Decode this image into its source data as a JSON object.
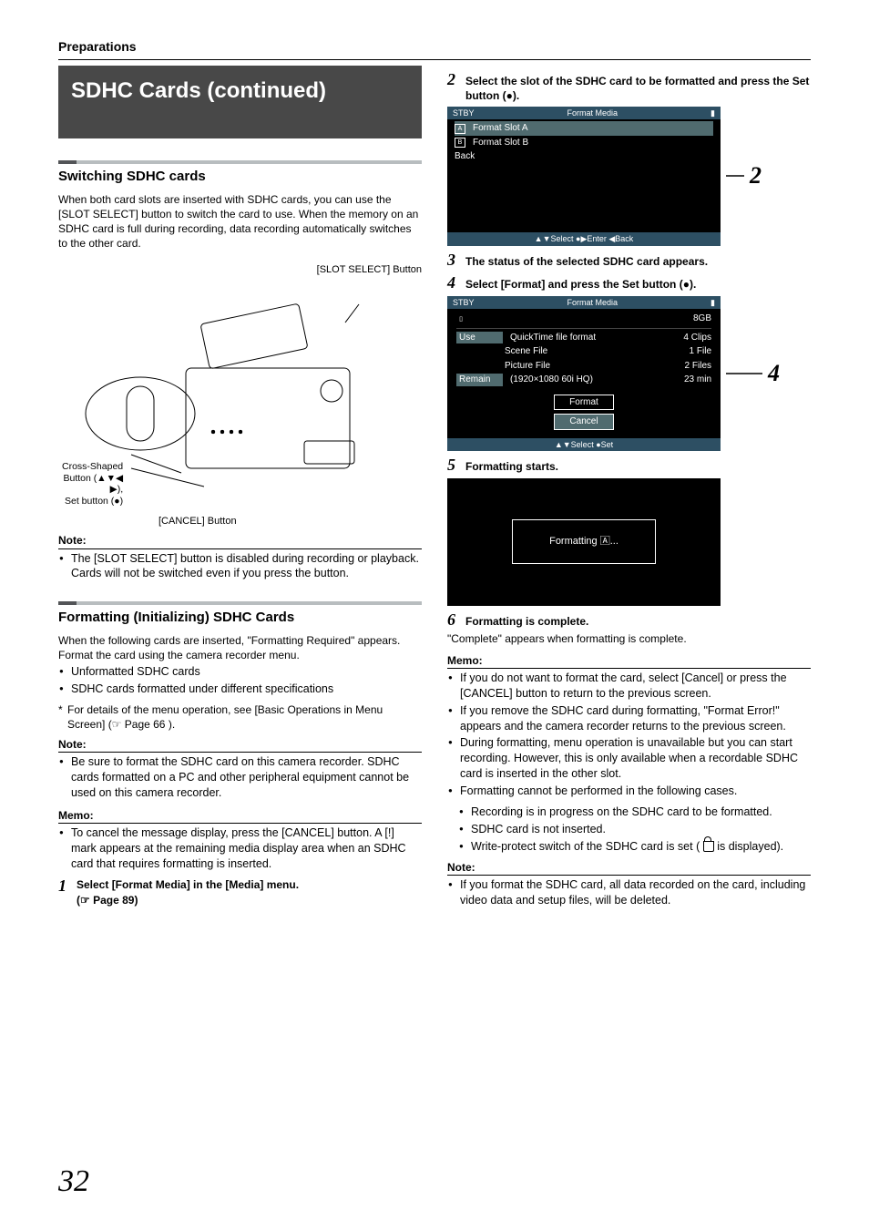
{
  "header": "Preparations",
  "title": "SDHC Cards (continued)",
  "page_number": "32",
  "sec1": {
    "heading": "Switching SDHC cards",
    "para": "When both card slots are inserted with SDHC cards, you can use the [SLOT SELECT] button to switch the card to use. When the memory on an SDHC card is full during recording, data recording automatically switches to the other card.",
    "diagram_top": "[SLOT SELECT] Button",
    "diagram_left1": "Cross-Shaped",
    "diagram_left2": "Button (▲▼◀",
    "diagram_left3": "▶),",
    "diagram_left4": "Set button (●)",
    "diagram_bottom": "[CANCEL] Button",
    "note_label": "Note:",
    "note1": "The [SLOT SELECT] button is disabled during recording or playback. Cards will not be switched even if you press the button."
  },
  "sec2": {
    "heading": "Formatting (Initializing) SDHC Cards",
    "para": "When the following cards are inserted, \"Formatting Required\" appears. Format the card using the camera recorder menu.",
    "b1": "Unformatted SDHC cards",
    "b2": "SDHC cards formatted under different specifications",
    "star": "For details of the menu operation, see [Basic Operations in Menu Screen] (☞ Page 66 ).",
    "note_label": "Note:",
    "note1": "Be sure to format the SDHC card on this camera recorder. SDHC cards formatted on a PC and other peripheral equipment cannot be used on this camera recorder.",
    "memo_label": "Memo:",
    "memo1": "To cancel the message display, press the [CANCEL] button. A [!] mark appears at the remaining media display area when an SDHC card that requires formatting is inserted.",
    "step1_num": "1",
    "step1": "Select [Format Media] in the [Media] menu.",
    "step1_ref": "(☞ Page 89)"
  },
  "right": {
    "step2_num": "2",
    "step2": "Select the slot of the SDHC card to be formatted and press the Set button (●).",
    "annot2": "2",
    "screen1": {
      "stby": "STBY",
      "title": "Format Media",
      "rowA": "Format Slot A",
      "rowB": "Format Slot B",
      "back": "Back",
      "foot": "▲▼Select  ●▶Enter  ◀Back"
    },
    "step3_num": "3",
    "step3": "The status of the selected SDHC card appears.",
    "step4_num": "4",
    "step4": "Select [Format] and press the Set button (●).",
    "annot4": "4",
    "screen2": {
      "stby": "STBY",
      "title": "Format Media",
      "cap": "8GB",
      "r1l": "Use",
      "r1c": "QuickTime file format",
      "r1r": "4 Clips",
      "r2c": "Scene File",
      "r2r": "1 File",
      "r3c": "Picture File",
      "r3r": "2 Files",
      "r4l": "Remain",
      "r4c": "(1920×1080 60i HQ)",
      "r4r": "23 min",
      "btn_format": "Format",
      "btn_cancel": "Cancel",
      "foot": "▲▼Select   ●Set"
    },
    "step5_num": "5",
    "step5": "Formatting starts.",
    "screen3": "Formatting 🄰...",
    "step6_num": "6",
    "step6": "Formatting is complete.",
    "step6_body": "\"Complete\" appears when formatting is complete.",
    "memo_label": "Memo:",
    "m1": "If you do not want to format the card, select [Cancel] or press the [CANCEL] button to return to the previous screen.",
    "m2": "If you remove the SDHC card during formatting, \"Format Error!\" appears and the camera recorder returns to the previous screen.",
    "m3": "During formatting, menu operation is unavailable but you can start recording. However, this is only available when a recordable SDHC card is inserted in the other slot.",
    "m4": "Formatting cannot be performed in the following cases.",
    "m4a": "Recording is in progress on the SDHC card to be formatted.",
    "m4b": "SDHC card is not inserted.",
    "m4c_pre": "Write-protect switch of the SDHC card is set (",
    "m4c_post": " is displayed).",
    "note_label": "Note:",
    "note1": "If you format the SDHC card, all data recorded on the card, including video data and setup files, will be deleted."
  }
}
